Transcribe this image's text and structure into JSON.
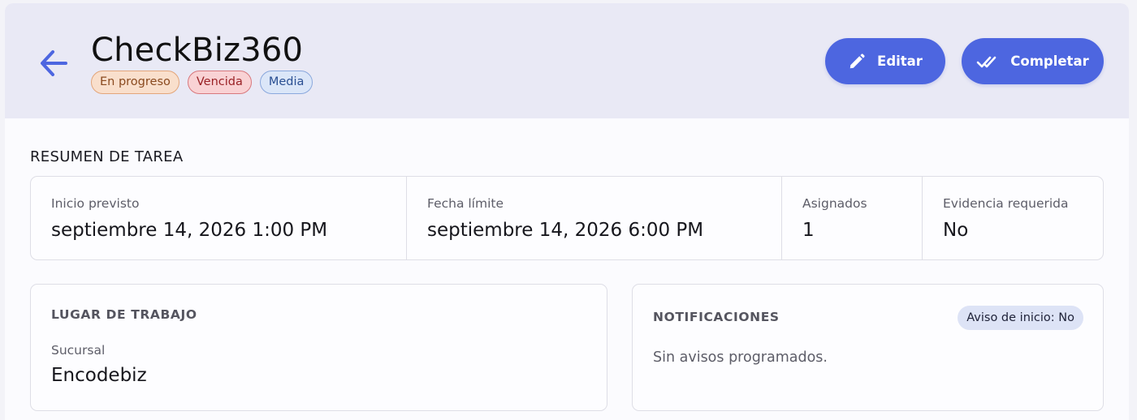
{
  "header": {
    "title": "CheckBiz360",
    "badges": {
      "status": "En progreso",
      "due": "Vencida",
      "priority": "Media"
    },
    "actions": {
      "edit": "Editar",
      "complete": "Completar"
    }
  },
  "summary": {
    "title": "RESUMEN DE TAREA",
    "start_label": "Inicio previsto",
    "start_value": "septiembre 14, 2026 1:00 PM",
    "deadline_label": "Fecha límite",
    "deadline_value": "septiembre 14, 2026 6:00 PM",
    "assigned_label": "Asignados",
    "assigned_value": "1",
    "evidence_label": "Evidencia requerida",
    "evidence_value": "No"
  },
  "workplace": {
    "title": "LUGAR DE TRABAJO",
    "branch_label": "Sucursal",
    "branch_value": "Encodebiz"
  },
  "notifications": {
    "title": "NOTIFICACIONES",
    "start_notice": "Aviso de inicio: No",
    "empty": "Sin avisos programados."
  },
  "colors": {
    "accent": "#4d66e0",
    "header_bg": "#e9e9f5",
    "badge_progress": "#f9dfcc",
    "badge_overdue": "#f9d2d4",
    "badge_media": "#dbe6f8"
  },
  "icons": {
    "back": "arrow-left-icon",
    "edit": "pencil-icon",
    "complete": "double-check-icon"
  }
}
